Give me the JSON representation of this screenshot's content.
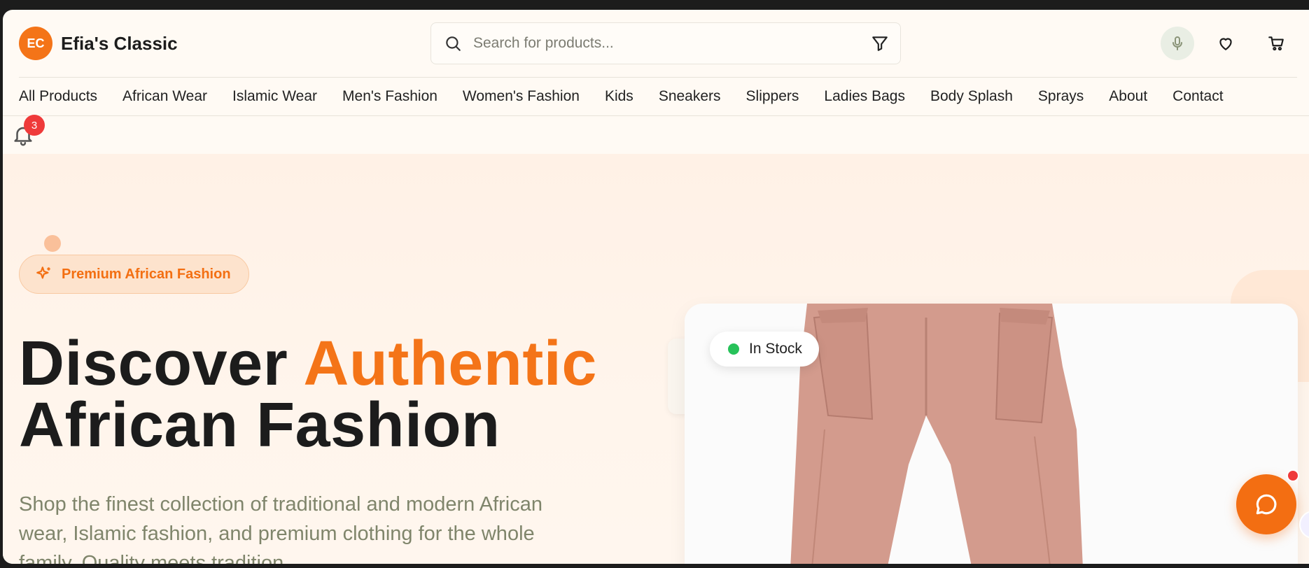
{
  "brand": {
    "initials": "EC",
    "name": "Efia's Classic",
    "accent": "#f47418"
  },
  "search": {
    "placeholder": "Search for products..."
  },
  "header_icons": [
    "search-icon",
    "filter-icon",
    "microphone-icon",
    "heart-icon",
    "cart-icon"
  ],
  "nav": {
    "items": [
      "All Products",
      "African Wear",
      "Islamic Wear",
      "Men's Fashion",
      "Women's Fashion",
      "Kids",
      "Sneakers",
      "Slippers",
      "Ladies Bags",
      "Body Splash",
      "Sprays",
      "About",
      "Contact"
    ]
  },
  "notifications": {
    "count": "3"
  },
  "hero": {
    "badge": "Premium African Fashion",
    "headline_part1": "Discover ",
    "headline_accent": "Authentic",
    "headline_part2": "African Fashion",
    "subtext": "Shop the finest collection of traditional and modern African wear, Islamic fashion, and premium clothing for the whole family. Quality meets tradition.",
    "stock_label": "In Stock"
  }
}
